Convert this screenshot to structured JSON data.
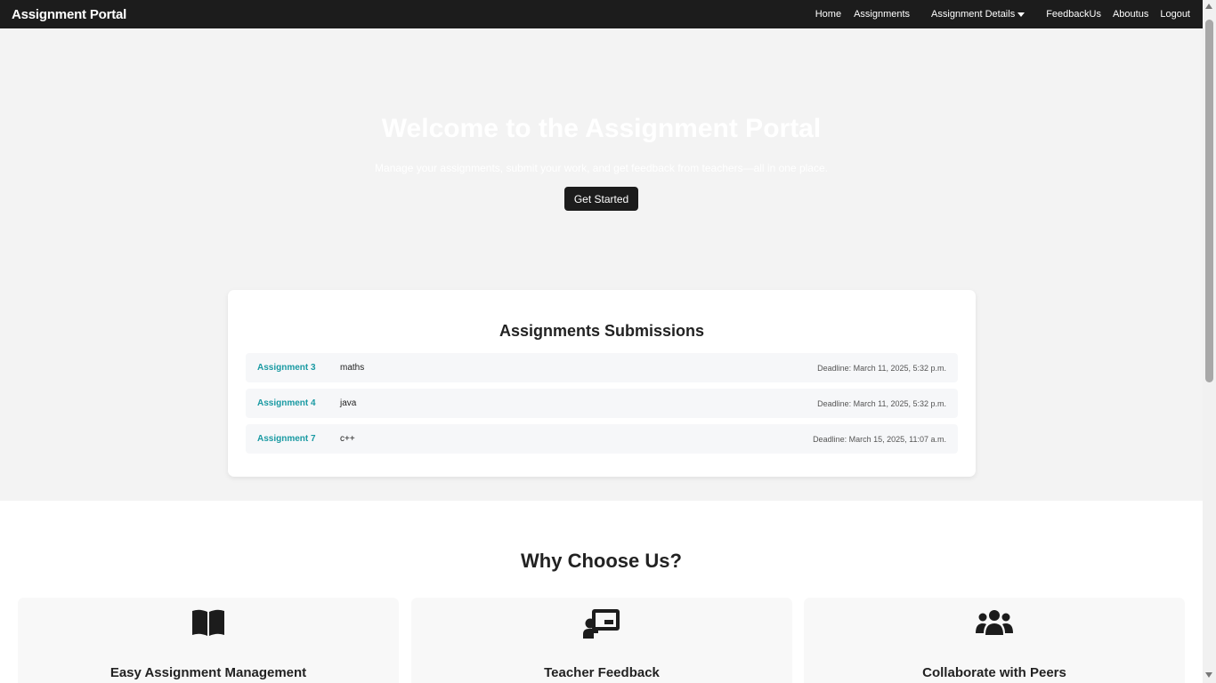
{
  "navbar": {
    "brand": "Assignment Portal",
    "links": {
      "home": "Home",
      "assignments": "Assignments",
      "details": "Assignment Details",
      "feedback": "FeedbackUs",
      "about": "Aboutus",
      "logout": "Logout"
    }
  },
  "hero": {
    "title": "Welcome to the Assignment Portal",
    "subtitle": "Manage your assignments, submit your work, and get feedback from teachers—all in one place.",
    "button": "Get Started"
  },
  "submissions": {
    "title": "Assignments Submissions",
    "items": [
      {
        "name": "Assignment 3",
        "subject": "maths",
        "deadline": "Deadline: March 11, 2025, 5:32 p.m."
      },
      {
        "name": "Assignment 4",
        "subject": "java",
        "deadline": "Deadline: March 11, 2025, 5:32 p.m."
      },
      {
        "name": "Assignment 7",
        "subject": "c++",
        "deadline": "Deadline: March 15, 2025, 11:07 a.m."
      }
    ]
  },
  "why": {
    "title": "Why Choose Us?",
    "features": [
      {
        "icon": "book-icon",
        "label": "Easy Assignment Management"
      },
      {
        "icon": "teacher-icon",
        "label": "Teacher Feedback"
      },
      {
        "icon": "users-icon",
        "label": "Collaborate with Peers"
      }
    ]
  },
  "colors": {
    "navbar": "#1c1c1c",
    "hero_bg": "#f3f3f3",
    "link_accent": "#1a9aa3"
  }
}
